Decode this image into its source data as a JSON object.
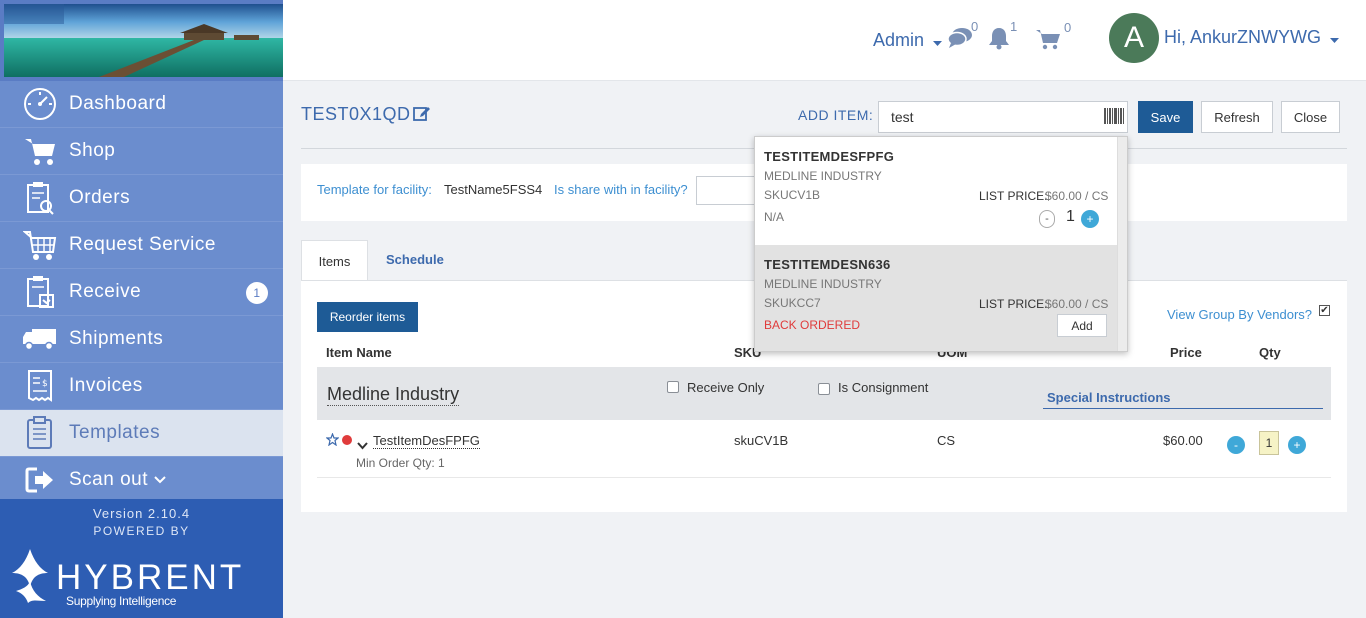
{
  "sidebar": {
    "items": [
      {
        "label": "Dashboard",
        "icon": "dashboard-icon"
      },
      {
        "label": "Shop",
        "icon": "cart-icon"
      },
      {
        "label": "Orders",
        "icon": "orders-icon"
      },
      {
        "label": "Request Service",
        "icon": "request-service-icon"
      },
      {
        "label": "Receive",
        "icon": "receive-icon",
        "badge": "1"
      },
      {
        "label": "Shipments",
        "icon": "truck-icon"
      },
      {
        "label": "Invoices",
        "icon": "invoice-icon"
      },
      {
        "label": "Templates",
        "icon": "templates-icon",
        "active": true
      },
      {
        "label": "Scan out",
        "icon": "scan-out-icon"
      }
    ],
    "version": "Version 2.10.4",
    "powered_by": "POWERED BY",
    "brand": "HYBRENT",
    "brand_tagline": "Supplying Intelligence"
  },
  "header": {
    "admin_label": "Admin",
    "messages_count": "0",
    "notifications_count": "1",
    "cart_count": "0",
    "avatar_letter": "A",
    "greeting": "Hi, AnkurZNWYWG"
  },
  "page": {
    "title": "TEST0X1QD",
    "add_item_label": "ADD ITEM:",
    "add_item_value": "test",
    "save_label": "Save",
    "refresh_label": "Refresh",
    "close_label": "Close"
  },
  "facility": {
    "template_label": "Template for facility:",
    "facility_name": "TestName5FSS4",
    "share_label": "Is share with in facility?"
  },
  "tabs": {
    "items": "Items",
    "schedule": "Schedule"
  },
  "items_panel": {
    "reorder_label": "Reorder items",
    "view_group_label": "View Group By Vendors?",
    "view_group_checked": true,
    "columns": {
      "item_name": "Item Name",
      "sku": "SKU",
      "uom": "UOM",
      "price": "Price",
      "qty": "Qty"
    },
    "vendor": {
      "name": "Medline Industry",
      "receive_only": "Receive Only",
      "is_consignment": "Is Consignment",
      "special_instructions": "Special Instructions"
    },
    "row": {
      "name": "TestItemDesFPFG",
      "min_order": "Min Order Qty: 1",
      "sku": "skuCV1B",
      "uom": "CS",
      "price": "$60.00",
      "qty": "1",
      "minus": "-",
      "plus": "+"
    }
  },
  "dropdown": {
    "items": [
      {
        "name": "TESTITEMDESFPFG",
        "vendor": "MEDLINE INDUSTRY",
        "sku": "SKUCV1B",
        "price_label": "LIST PRICE:",
        "price": "$60.00 / CS",
        "status": "N/A",
        "qty": "1",
        "minus": "-",
        "plus": "+"
      },
      {
        "name": "TESTITEMDESN636",
        "vendor": "MEDLINE INDUSTRY",
        "sku": "SKUKCC7",
        "price_label": "LIST PRICE:",
        "price": "$60.00 / CS",
        "status": "BACK ORDERED",
        "add_label": "Add"
      }
    ]
  },
  "colors": {
    "sidebar": "#5a7cc4",
    "primary_button": "#1e5b96",
    "link": "#3d8fd1",
    "back_ordered": "#e03b3b"
  }
}
